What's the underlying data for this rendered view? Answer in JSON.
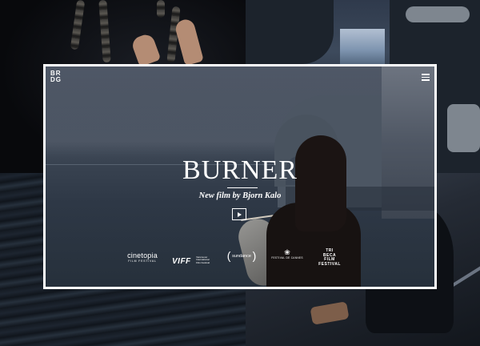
{
  "brand": {
    "logo_line1": "BR",
    "logo_line2": "DG"
  },
  "hero": {
    "title": "BURNER",
    "subtitle": "New film by Bjorn Kalo"
  },
  "festivals": {
    "cinetopia_name": "cinetopia",
    "cinetopia_sub": "FILM FESTIVAL",
    "viff_name": "VIFF",
    "viff_sub": "Vancouver International Film Festival",
    "sundance_name": "sundance",
    "cannes_sub": "FESTIVAL DE CANNES",
    "tribeca_line1": "TRI",
    "tribeca_line2": "BECA",
    "tribeca_line3": "FILM",
    "tribeca_line4": "FESTIVAL"
  },
  "icons": {
    "menu": "hamburger-menu-icon",
    "play": "play-icon",
    "cannes": "palm-icon",
    "laurel": "laurel-icon"
  },
  "colors": {
    "frame": "#ffffff",
    "text": "#ffffff",
    "background": "#0b0d12"
  }
}
